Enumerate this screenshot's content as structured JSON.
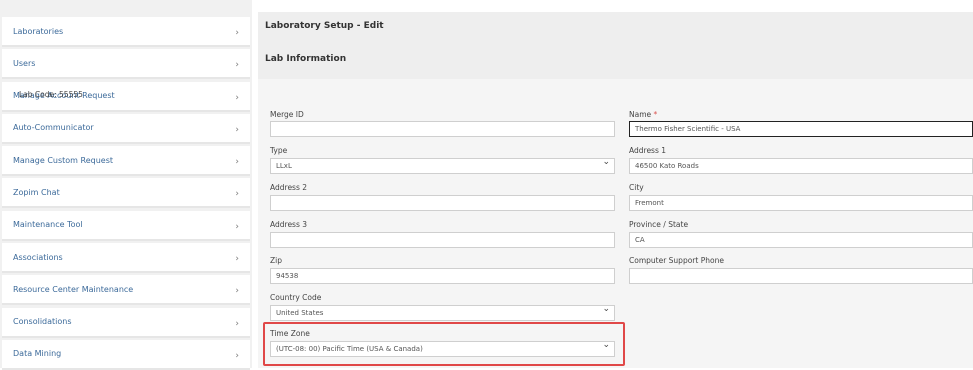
{
  "sidebar": {
    "items": [
      {
        "label": "Laboratories"
      },
      {
        "label": "Users"
      },
      {
        "label": "Manage Account Request"
      },
      {
        "label": "Auto-Communicator"
      },
      {
        "label": "Manage Custom Request"
      },
      {
        "label": "Zopim Chat"
      },
      {
        "label": "Maintenance Tool"
      },
      {
        "label": "Associations"
      },
      {
        "label": "Resource Center Maintenance"
      },
      {
        "label": "Consolidations"
      },
      {
        "label": "Data Mining"
      }
    ],
    "chevron": "›"
  },
  "header": {
    "title": "Laboratory Setup - Edit",
    "section": "Lab Information"
  },
  "form": {
    "lab_code": "Lab Code: 55555",
    "merge_id": {
      "label": "Merge ID",
      "value": ""
    },
    "name": {
      "label": "Name",
      "required_mark": "*",
      "value": "Thermo Fisher Scientific - USA"
    },
    "type": {
      "label": "Type",
      "value": "LLxL"
    },
    "address1": {
      "label": "Address 1",
      "value": "46500 Kato Roads"
    },
    "address2": {
      "label": "Address 2",
      "value": ""
    },
    "city": {
      "label": "City",
      "value": "Fremont"
    },
    "address3": {
      "label": "Address 3",
      "value": ""
    },
    "province": {
      "label": "Province / State",
      "value": "CA"
    },
    "zip": {
      "label": "Zip",
      "value": "94538"
    },
    "support_phone": {
      "label": "Computer Support Phone",
      "value": ""
    },
    "country": {
      "label": "Country Code",
      "value": "United States"
    },
    "timezone": {
      "label": "Time Zone",
      "value": "(UTC-08: 00) Pacific Time (USA & Canada)"
    }
  },
  "colors": {
    "accent": "#3c6a9a",
    "highlight": "#e04848"
  }
}
